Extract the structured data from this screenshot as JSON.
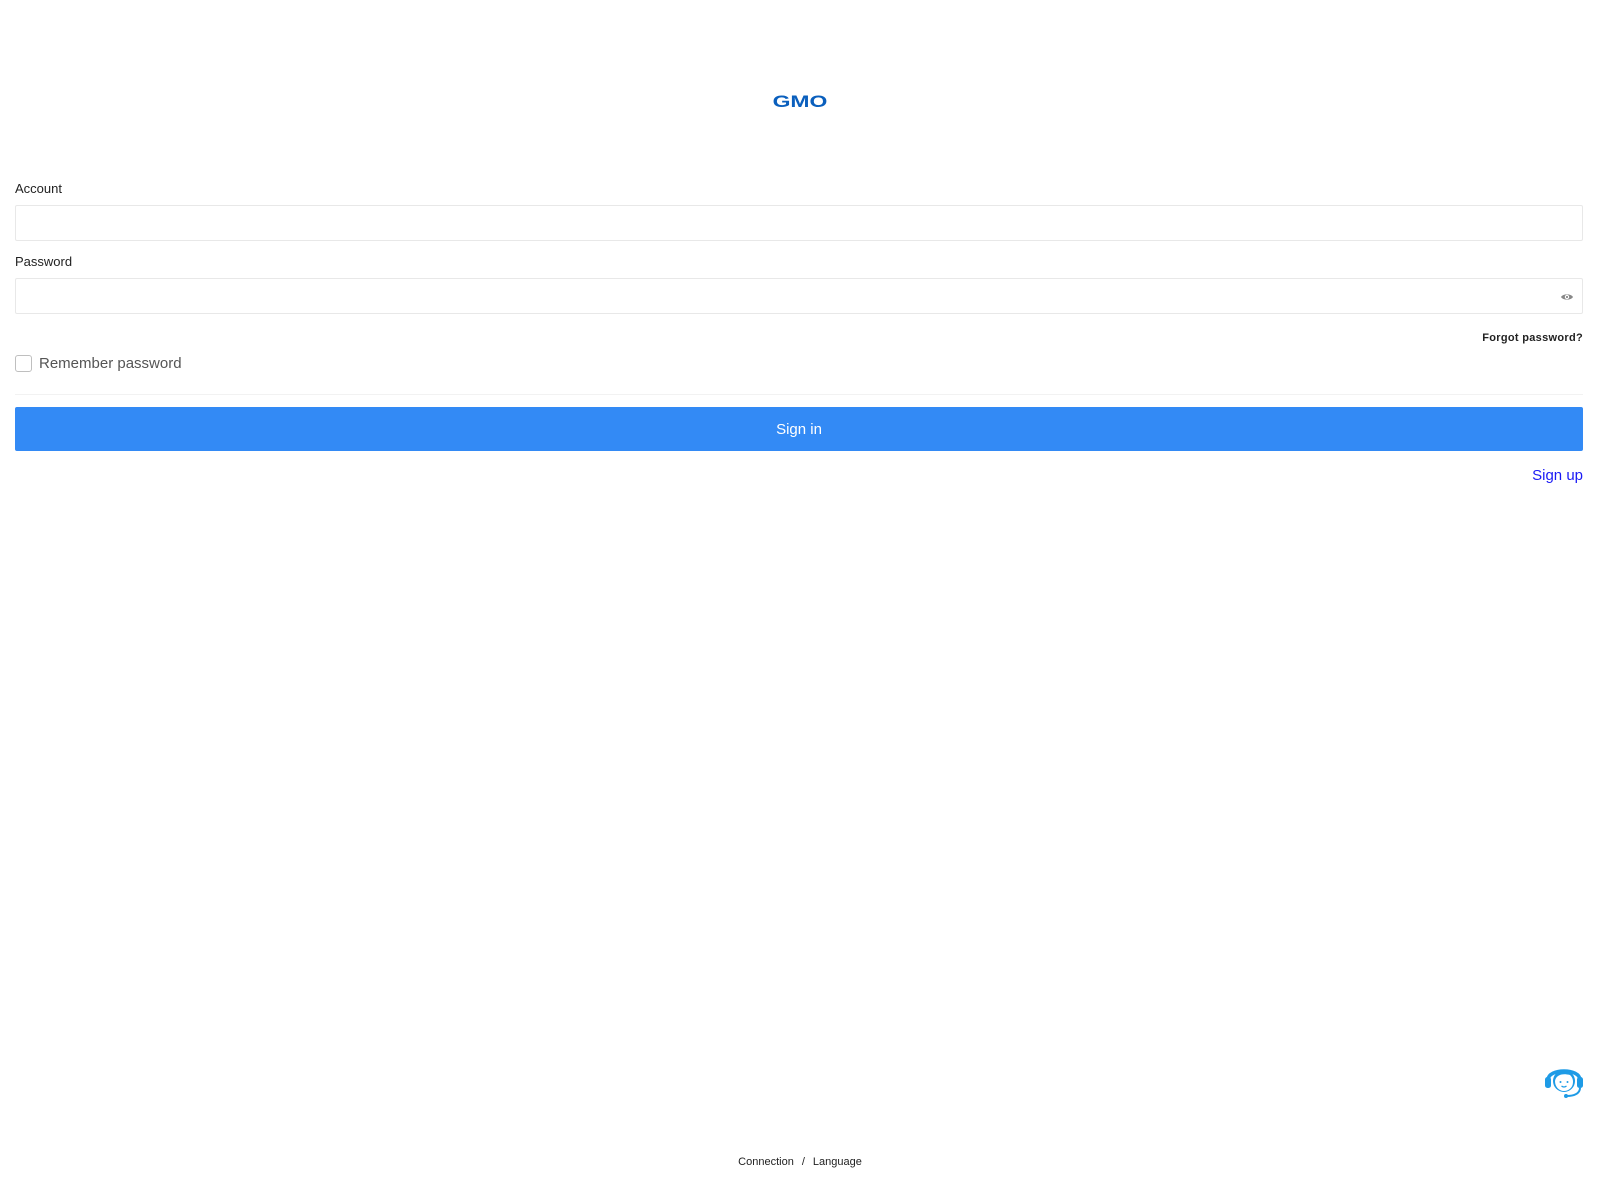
{
  "brand": {
    "logo_text": "GMO",
    "color": "#0a5fbd"
  },
  "form": {
    "account_label": "Account",
    "account_value": "",
    "password_label": "Password",
    "password_value": "",
    "forgot_password": "Forgot password?",
    "remember_label": "Remember password",
    "remember_checked": false,
    "signin_label": "Sign in",
    "signup_label": "Sign up",
    "accent_color": "#338af5"
  },
  "icons": {
    "password_toggle": "eye-icon",
    "support": "headset-support-icon"
  },
  "footer": {
    "connection": "Connection",
    "separator": "/",
    "language": "Language"
  }
}
